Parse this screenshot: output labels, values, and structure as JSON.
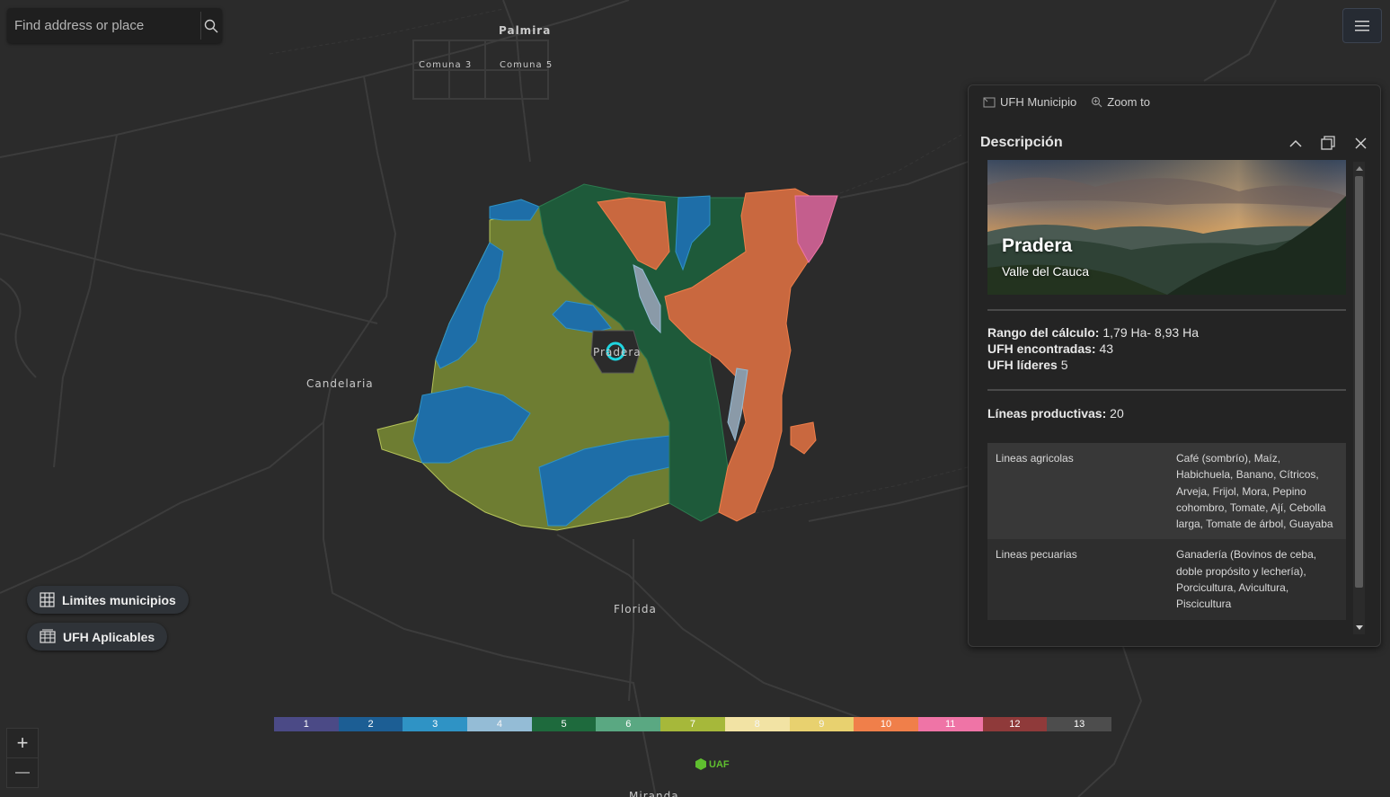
{
  "search": {
    "placeholder": "Find address or place"
  },
  "map_labels": {
    "palmira": "Palmira",
    "comuna3": "Comuna 3",
    "comuna5": "Comuna 5",
    "candelaria": "Candelaria",
    "pradera": "Pradera",
    "florida": "Florida",
    "miranda": "Miranda"
  },
  "popup": {
    "actions": [
      {
        "label": "UFH Municipio",
        "icon": "selection-icon"
      },
      {
        "label": "Zoom to",
        "icon": "zoom-to-icon"
      }
    ],
    "title": "Descripción",
    "hero": {
      "title": "Pradera",
      "subtitle": "Valle del Cauca"
    },
    "stats": {
      "rango_label": "Rango del cálculo:",
      "rango_value": " 1,79 Ha- 8,93 Ha",
      "encontradas_label": "UFH encontradas:",
      "encontradas_value": " 43",
      "lideres_label": "UFH líderes",
      "lideres_value": " 5",
      "lineas_label": "Líneas productivas:",
      "lineas_value": " 20"
    },
    "table": [
      {
        "key": "Lineas agricolas",
        "value": "Café (sombrío), Maíz, Habichuela, Banano, Cítricos, Arveja, Frijol, Mora, Pepino cohombro, Tomate, Ají, Cebolla larga, Tomate de árbol, Guayaba"
      },
      {
        "key": "Lineas pecuarias",
        "value": "Ganadería (Bovinos de ceba, doble propósito y lechería), Porcicultura, Avicultura, Piscicultura"
      }
    ]
  },
  "layers": {
    "limites": "Limites municipios",
    "ufh": "UFH Aplicables"
  },
  "legend": [
    {
      "label": "1",
      "color": "#4b4a86"
    },
    {
      "label": "2",
      "color": "#1c5e94"
    },
    {
      "label": "3",
      "color": "#2f93c5"
    },
    {
      "label": "4",
      "color": "#94bcd6"
    },
    {
      "label": "5",
      "color": "#1e6a3d"
    },
    {
      "label": "6",
      "color": "#5aa882"
    },
    {
      "label": "7",
      "color": "#a6b83a"
    },
    {
      "label": "8",
      "color": "#f2e3a4"
    },
    {
      "label": "9",
      "color": "#e8d16f"
    },
    {
      "label": "10",
      "color": "#f07f4a"
    },
    {
      "label": "11",
      "color": "#ef74a6"
    },
    {
      "label": "12",
      "color": "#8f3a3a"
    },
    {
      "label": "13",
      "color": "#4d4d4d"
    }
  ],
  "zoom": {
    "in": "+",
    "out": "—"
  },
  "logo": "UAF"
}
